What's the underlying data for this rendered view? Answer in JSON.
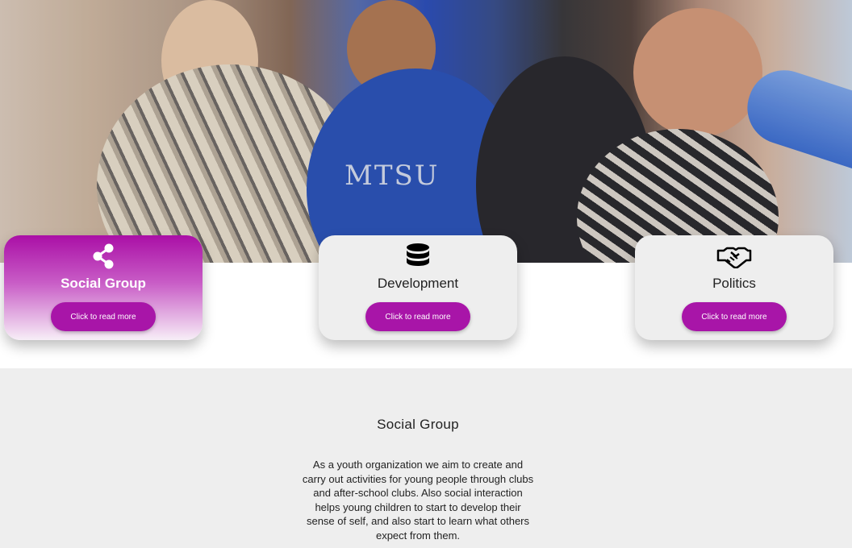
{
  "hero": {
    "shirt_text": "MTSU"
  },
  "cards": [
    {
      "icon": "share-icon",
      "title": "Social Group",
      "button": "Click to read more",
      "active": true
    },
    {
      "icon": "database-icon",
      "title": "Development",
      "button": "Click to read more",
      "active": false
    },
    {
      "icon": "handshake-icon",
      "title": "Politics",
      "button": "Click to read more",
      "active": false
    }
  ],
  "section": {
    "title": "Social Group",
    "body": "As a youth organization we aim to create and carry out activities for young people through clubs and after-school clubs. Also social interaction helps young children to start to develop their sense of self, and also start to learn what others expect from them."
  },
  "colors": {
    "accent": "#a815a8",
    "card_bg": "#eeeeee",
    "band_bg": "#eeeeee"
  }
}
